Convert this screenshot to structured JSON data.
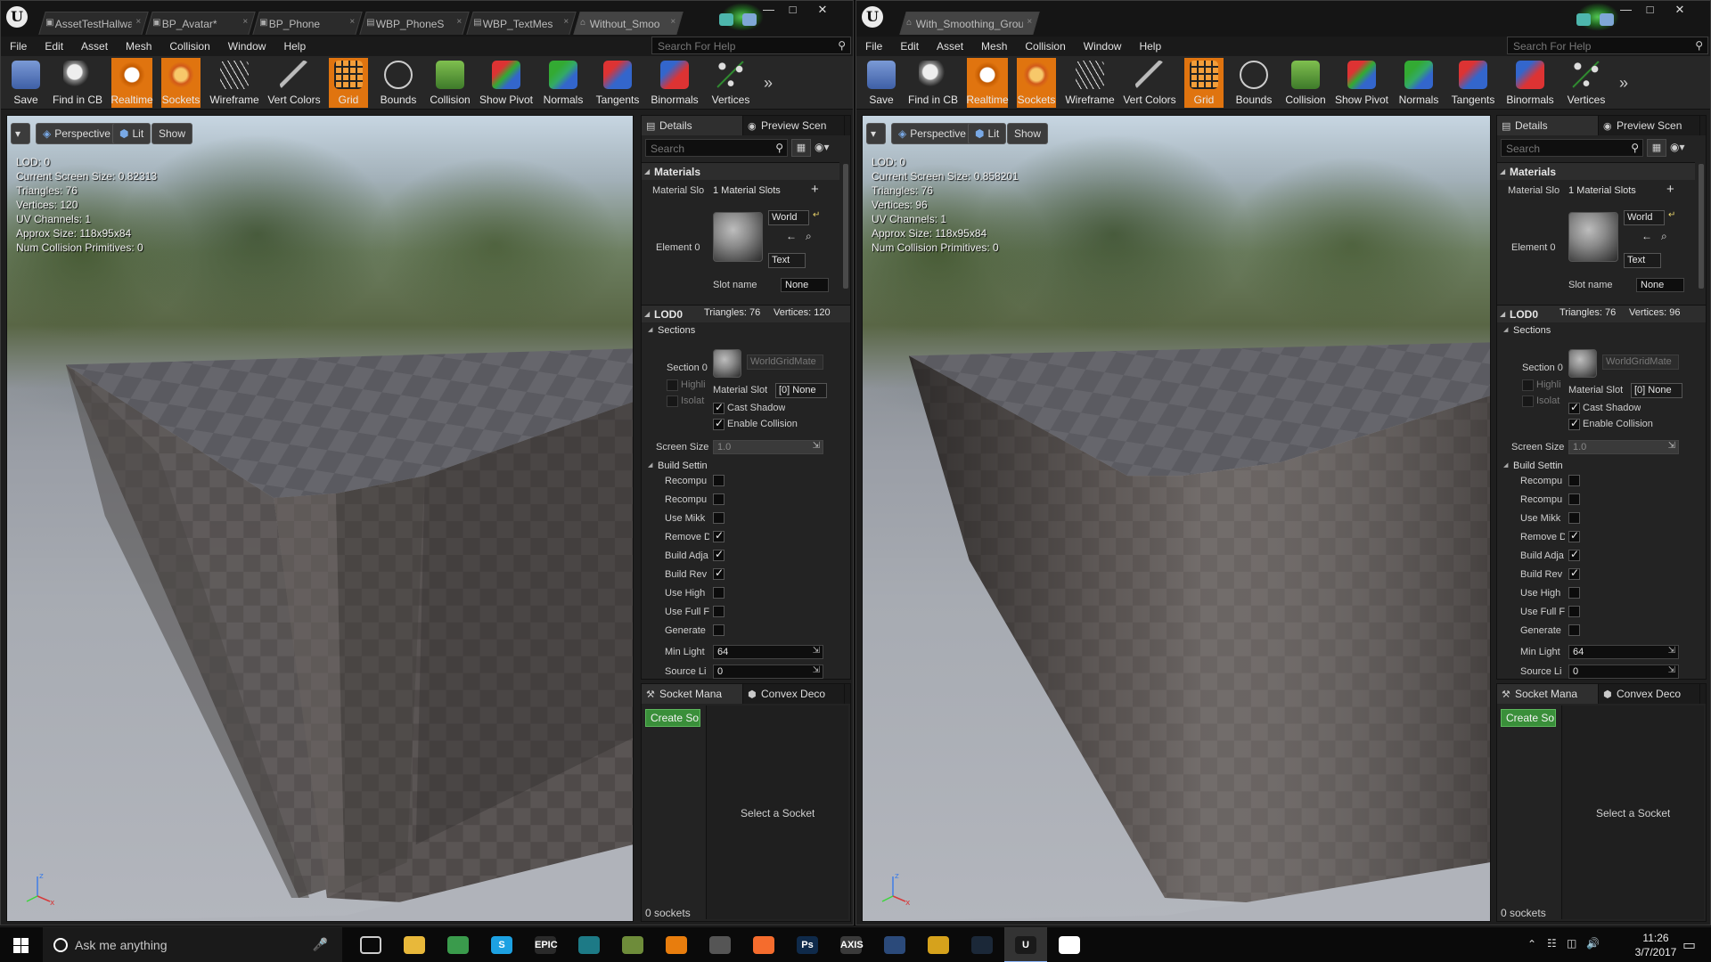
{
  "left": {
    "tabs": [
      {
        "label": "AssetTestHallwa",
        "icon": "asset-icon"
      },
      {
        "label": "BP_Avatar*",
        "icon": "blueprint-icon"
      },
      {
        "label": "BP_Phone",
        "icon": "blueprint-icon"
      },
      {
        "label": "WBP_PhoneS",
        "icon": "widget-icon"
      },
      {
        "label": "WBP_TextMes",
        "icon": "widget-icon"
      },
      {
        "label": "Without_Smoo",
        "icon": "static-mesh-icon"
      }
    ],
    "viewport": {
      "stats": [
        "LOD:  0",
        "Current Screen Size:  0.82313",
        "Triangles:  76",
        "Vertices:  120",
        "UV Channels:  1",
        "Approx Size: 118x95x84",
        "Num Collision Primitives:  0"
      ]
    },
    "details": {
      "lod_triangles": "Triangles: 76",
      "lod_vertices": "Vertices: 120"
    }
  },
  "right": {
    "tabs": [
      {
        "label": "With_Smoothing_Groups*",
        "icon": "static-mesh-icon"
      }
    ],
    "viewport": {
      "stats": [
        "LOD:  0",
        "Current Screen Size:  0.858201",
        "Triangles:  76",
        "Vertices:  96",
        "UV Channels:  1",
        "Approx Size: 118x95x84",
        "Num Collision Primitives:  0"
      ]
    },
    "details": {
      "lod_triangles": "Triangles: 76",
      "lod_vertices": "Vertices: 96"
    }
  },
  "menu": [
    "File",
    "Edit",
    "Asset",
    "Mesh",
    "Collision",
    "Window",
    "Help"
  ],
  "help_search_placeholder": "Search For Help",
  "toolbar": [
    {
      "label": "Save",
      "icon": "save-icon",
      "on": false
    },
    {
      "label": "Find in CB",
      "icon": "find-in-cb-icon",
      "on": false
    },
    {
      "label": "Realtime",
      "icon": "realtime-icon",
      "on": true
    },
    {
      "label": "Sockets",
      "icon": "sockets-icon",
      "on": true
    },
    {
      "label": "Wireframe",
      "icon": "wireframe-icon",
      "on": false
    },
    {
      "label": "Vert Colors",
      "icon": "vert-colors-icon",
      "on": false
    },
    {
      "label": "Grid",
      "icon": "grid-icon",
      "on": true
    },
    {
      "label": "Bounds",
      "icon": "bounds-icon",
      "on": false
    },
    {
      "label": "Collision",
      "icon": "collision-icon",
      "on": false
    },
    {
      "label": "Show Pivot",
      "icon": "show-pivot-icon",
      "on": false
    },
    {
      "label": "Normals",
      "icon": "normals-icon",
      "on": false
    },
    {
      "label": "Tangents",
      "icon": "tangents-icon",
      "on": false
    },
    {
      "label": "Binormals",
      "icon": "binormals-icon",
      "on": false
    },
    {
      "label": "Vertices",
      "icon": "vertices-icon",
      "on": false
    }
  ],
  "vp_buttons": {
    "perspective": "Perspective",
    "lit": "Lit",
    "show": "Show"
  },
  "details_common": {
    "tab_details": "Details",
    "tab_preview": "Preview Scen",
    "search_placeholder": "Search",
    "materials_header": "Materials",
    "material_slots_label": "Material Slo",
    "material_slots_value": "1 Material Slots",
    "element0": "Element 0",
    "world_dd": "World",
    "text_dd": "Text",
    "slot_name_label": "Slot name",
    "slot_name_value": "None",
    "lod0": "LOD0",
    "sections": "Sections",
    "section0": "Section 0",
    "material_name": "WorldGridMate",
    "highlight": "Highli",
    "isolate": "Isolat",
    "material_slot_label": "Material Slot",
    "material_slot_value": "[0] None",
    "cast_shadow": "Cast Shadow",
    "enable_collision": "Enable Collision",
    "screen_size_label": "Screen Size",
    "screen_size_value": "1.0",
    "build_settings": "Build Settin",
    "build_rows": [
      {
        "label": "Recompu",
        "checked": false
      },
      {
        "label": "Recompu",
        "checked": false
      },
      {
        "label": "Use Mikk",
        "checked": false
      },
      {
        "label": "Remove D",
        "checked": true
      },
      {
        "label": "Build Adja",
        "checked": true
      },
      {
        "label": "Build Rev",
        "checked": true
      },
      {
        "label": "Use High",
        "checked": false
      },
      {
        "label": "Use Full F",
        "checked": false
      },
      {
        "label": "Generate",
        "checked": false
      }
    ],
    "min_light_label": "Min Light",
    "min_light_value": "64",
    "source_label": "Source Li",
    "source_value": "0"
  },
  "sockets": {
    "tab_socket": "Socket Mana",
    "tab_convex": "Convex Deco",
    "create": "Create So",
    "select": "Select a Socket",
    "count": "0 sockets"
  },
  "taskbar": {
    "search_placeholder": "Ask me anything",
    "apps": [
      {
        "name": "task-view-icon",
        "label": "",
        "color": "#0a0a0a"
      },
      {
        "name": "file-explorer-icon",
        "label": "",
        "color": "#e8b83a"
      },
      {
        "name": "chrome-icon",
        "label": "",
        "color": "#3a9b4c"
      },
      {
        "name": "skype-icon",
        "label": "S",
        "color": "#1da1e2"
      },
      {
        "name": "epic-launcher-icon",
        "label": "EPIC",
        "color": "#2a2a2a"
      },
      {
        "name": "monitor-app-icon",
        "label": "",
        "color": "#1d7a86"
      },
      {
        "name": "tree-app-icon",
        "label": "",
        "color": "#6e8c3a"
      },
      {
        "name": "blender-icon",
        "label": "",
        "color": "#e87d0d"
      },
      {
        "name": "unity-icon",
        "label": "",
        "color": "#555555"
      },
      {
        "name": "origin-icon",
        "label": "",
        "color": "#f56c2d"
      },
      {
        "name": "photoshop-icon",
        "label": "Ps",
        "color": "#0f2a4a"
      },
      {
        "name": "axis-app-icon",
        "label": "AXIS",
        "color": "#3a3a3a"
      },
      {
        "name": "globe-app-icon",
        "label": "",
        "color": "#2b4a7a"
      },
      {
        "name": "torch-app-icon",
        "label": "",
        "color": "#d6a21c"
      },
      {
        "name": "steam-icon",
        "label": "",
        "color": "#1b2838"
      },
      {
        "name": "unreal-engine-icon",
        "label": "U",
        "color": "#1a1a1a"
      },
      {
        "name": "mail-app-icon",
        "label": "",
        "color": "#ffffff"
      }
    ],
    "time": "11:26",
    "date": "3/7/2017"
  }
}
